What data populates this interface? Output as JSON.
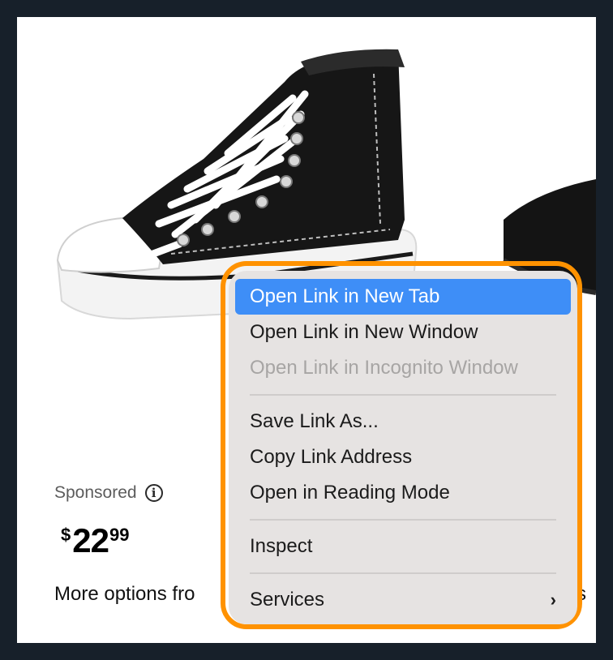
{
  "product": {
    "sponsored_label": "Sponsored",
    "info_icon": "i",
    "price_currency": "$",
    "price_main": "22",
    "price_cents": "99",
    "more_options_text": "More options fro",
    "more_options_tail": "s"
  },
  "context_menu": {
    "items": [
      {
        "label": "Open Link in New Tab"
      },
      {
        "label": "Open Link in New Window"
      },
      {
        "label": "Open Link in Incognito Window"
      },
      {
        "label": "Save Link As..."
      },
      {
        "label": "Copy Link Address"
      },
      {
        "label": "Open in Reading Mode"
      },
      {
        "label": "Inspect"
      },
      {
        "label": "Services",
        "chevron": "›"
      }
    ]
  },
  "colors": {
    "highlight": "#ff9200",
    "menu_background": "#e6e3e2",
    "active_item": "#3e8ef7"
  }
}
